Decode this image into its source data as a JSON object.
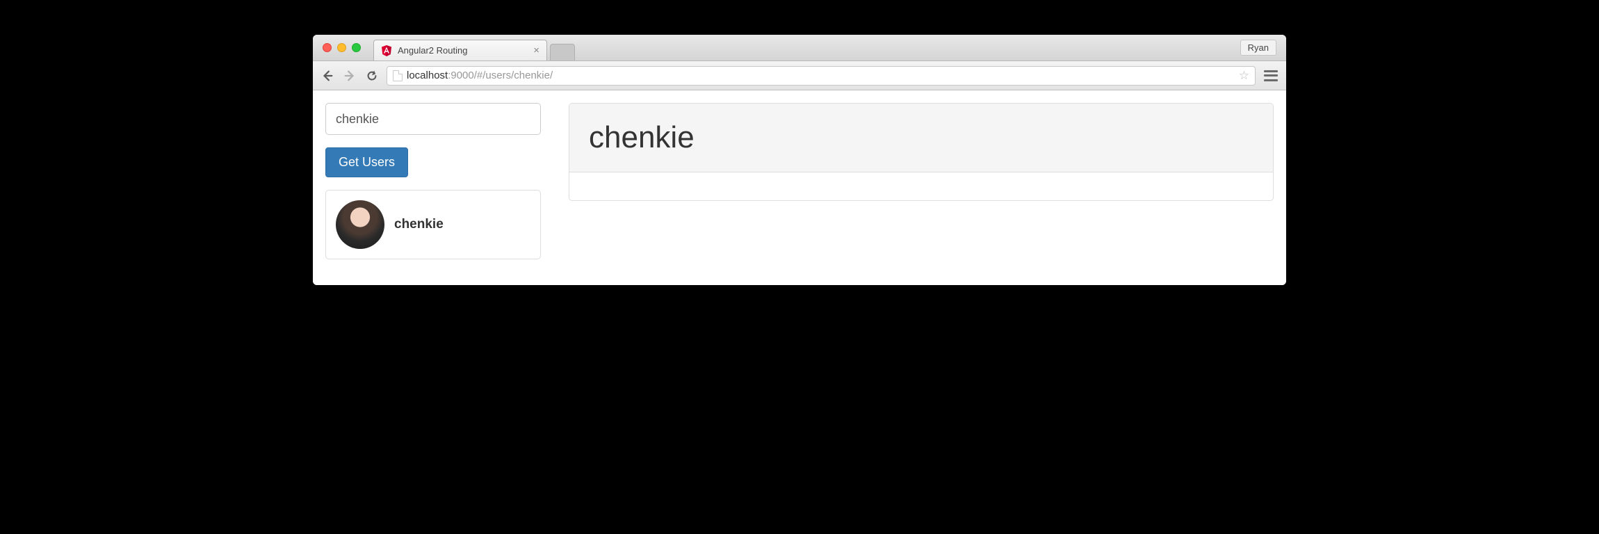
{
  "browser": {
    "tab_title": "Angular2 Routing",
    "profile_name": "Ryan",
    "url_host": "localhost",
    "url_port_path": ":9000/#/users/chenkie/"
  },
  "sidebar": {
    "search_value": "chenkie",
    "get_users_label": "Get Users",
    "user_result_name": "chenkie"
  },
  "main": {
    "panel_title": "chenkie"
  }
}
